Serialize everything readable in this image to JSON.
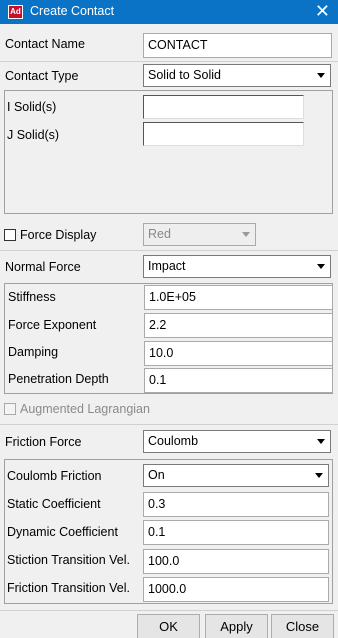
{
  "window": {
    "title": "Create Contact",
    "icon_text": "Ad",
    "close_glyph": "✕"
  },
  "contact": {
    "name_label": "Contact Name",
    "name_value": "CONTACT",
    "type_label": "Contact Type",
    "type_value": "Solid to Solid",
    "i_solid_label": "I Solid(s)",
    "j_solid_label": "J Solid(s)",
    "i_solid_value": "",
    "j_solid_value": ""
  },
  "force_display": {
    "label": "Force Display",
    "value": "Red",
    "checked": false
  },
  "normal_force": {
    "label": "Normal Force",
    "value": "Impact",
    "fields": [
      {
        "label": "Stiffness",
        "value": "1.0E+05"
      },
      {
        "label": "Force Exponent",
        "value": "2.2"
      },
      {
        "label": "Damping",
        "value": "10.0"
      },
      {
        "label": "Penetration Depth",
        "value": "0.1"
      }
    ]
  },
  "augmented": {
    "label": "Augmented Lagrangian",
    "checked": false
  },
  "friction": {
    "label": "Friction Force",
    "value": "Coulomb",
    "coulomb_label": "Coulomb Friction",
    "coulomb_value": "On",
    "fields": [
      {
        "label": "Static Coefficient",
        "value": "0.3"
      },
      {
        "label": "Dynamic Coefficient",
        "value": "0.1"
      },
      {
        "label": "Stiction Transition Vel.",
        "value": "100.0"
      },
      {
        "label": "Friction Transition Vel.",
        "value": "1000.0"
      }
    ]
  },
  "buttons": {
    "ok": "OK",
    "apply": "Apply",
    "close": "Close"
  }
}
